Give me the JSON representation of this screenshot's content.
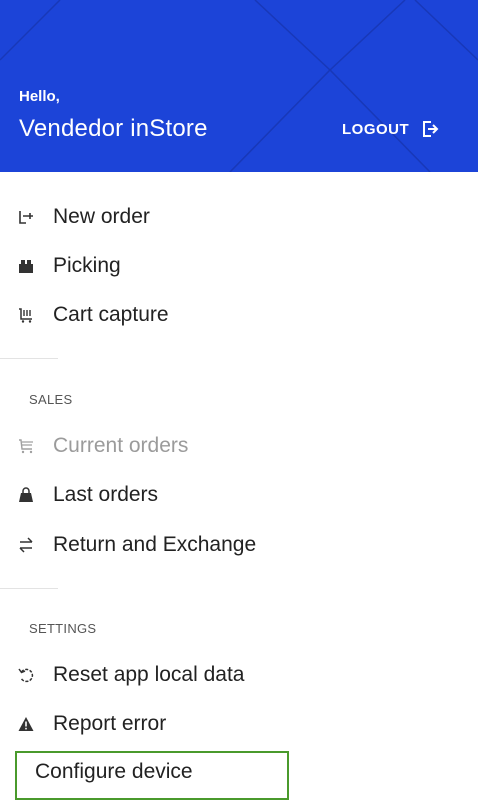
{
  "header": {
    "greeting": "Hello,",
    "user_name": "Vendedor inStore",
    "logout_label": "LOGOUT",
    "background_color": "#1c44d8"
  },
  "menu": {
    "items": [
      {
        "label": "New order",
        "icon": "new-order-icon"
      },
      {
        "label": "Picking",
        "icon": "picking-box-icon"
      },
      {
        "label": "Cart capture",
        "icon": "cart-capture-icon"
      }
    ]
  },
  "sales": {
    "section_label": "SALES",
    "items": [
      {
        "label": "Current orders",
        "icon": "cart-icon",
        "disabled": true
      },
      {
        "label": "Last orders",
        "icon": "bag-icon"
      },
      {
        "label": "Return and Exchange",
        "icon": "exchange-arrows-icon"
      }
    ]
  },
  "settings": {
    "section_label": "SETTINGS",
    "items": [
      {
        "label": "Reset app local data",
        "icon": "reset-icon"
      },
      {
        "label": "Report error",
        "icon": "warning-icon"
      },
      {
        "label": "Configure device"
      }
    ]
  },
  "colors": {
    "accent": "#1c44d8",
    "highlight_border": "#4a9a2c",
    "disabled_text": "#9b9b9b"
  }
}
